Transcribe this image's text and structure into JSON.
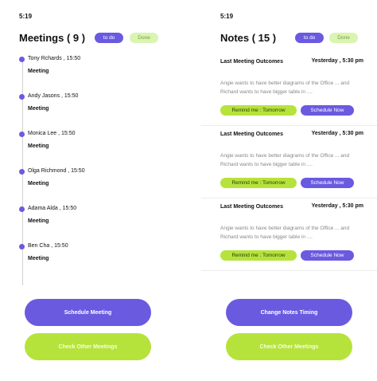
{
  "left": {
    "status_time": "5:19",
    "title": "Meetings ( 9 )",
    "todo_label": "to do",
    "done_label": "Done",
    "meetings": [
      {
        "who": "Tony Rchards ,  15:50",
        "title": "Meeting"
      },
      {
        "who": "Andy Jasons ,  15:50",
        "title": "Meeting"
      },
      {
        "who": "Monica Lee ,  15:50",
        "title": "Meeting"
      },
      {
        "who": "Olga Richmond ,  15:50",
        "title": "Meeting"
      },
      {
        "who": "Adama Alda ,  15:50",
        "title": "Meeting"
      },
      {
        "who": "Ben Cha ,  15:50",
        "title": "Meeting"
      }
    ],
    "primary_button": "Schedule Meeting",
    "secondary_button": "Check Other  Meetings"
  },
  "right": {
    "status_time": "5:19",
    "title": "Notes ( 15 )",
    "todo_label": "to do",
    "done_label": "Done",
    "notes": [
      {
        "title": "Last Meeting Outcomes",
        "time": "Yesterday , 5:30 pm",
        "body": "Angie wants to have better diagrams of the Office ... and Richard wants to have bigger table in ....",
        "remind": "Remind me : Tomorrow",
        "schedule": "Schedule Now"
      },
      {
        "title": "Last Meeting Outcomes",
        "time": "Yesterday , 5:30 pm",
        "body": "Angie wants to have better diagrams of the Office ... and Richard wants to have bigger table in ....",
        "remind": "Remind me : Tomorrow",
        "schedule": "Schedule Now"
      },
      {
        "title": "Last Meeting Outcomes",
        "time": "Yesterday , 5:30 pm",
        "body": "Angie wants to have better diagrams of the Office ... and Richard wants to have bigger table in ....",
        "remind": "Remind me : Tomorrow",
        "schedule": "Schedule Now"
      }
    ],
    "primary_button": "Change Notes Timing",
    "secondary_button": "Check Other  Meetings"
  },
  "colors": {
    "accent": "#6a5ae0",
    "lime": "#b6e33b",
    "done_bg": "#d9f5b0"
  }
}
